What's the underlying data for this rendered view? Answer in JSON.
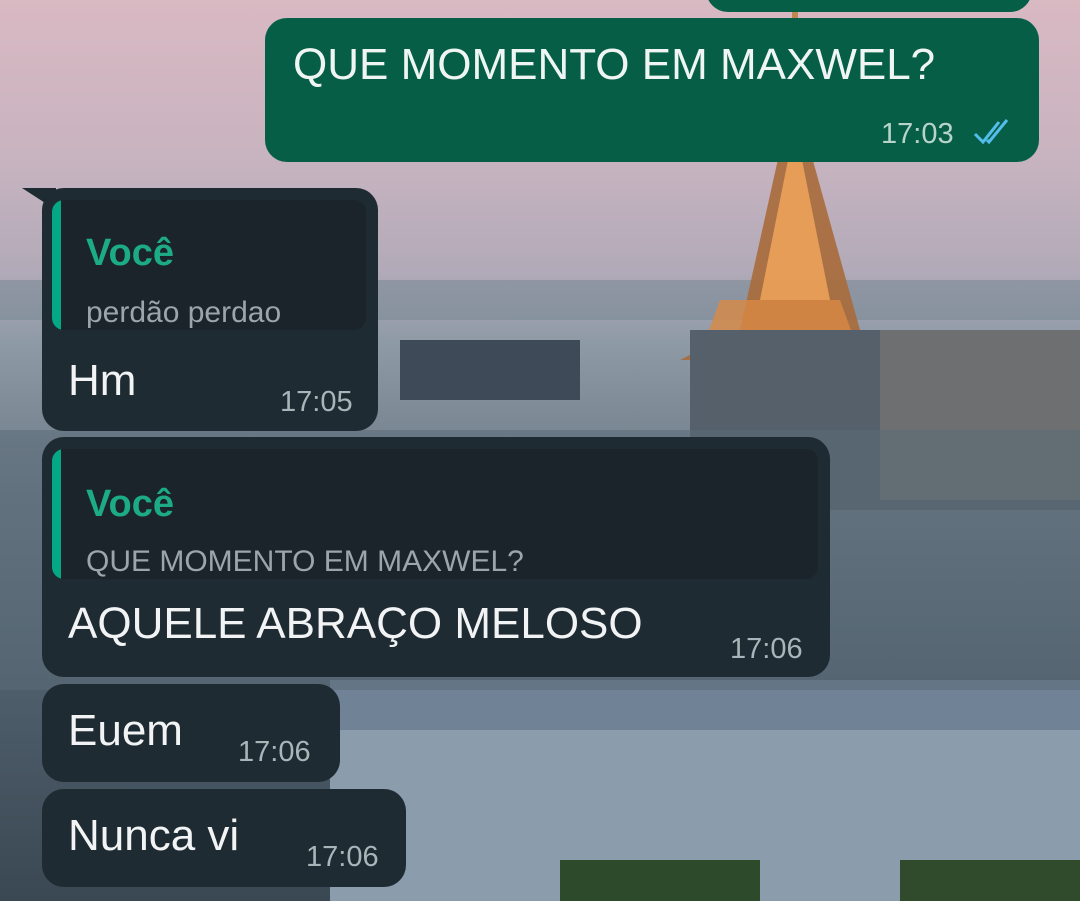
{
  "wallpaper": {
    "description_icon": "paris-eiffel-tower-wallpaper"
  },
  "colors": {
    "outgoing_bubble": "#075e47",
    "incoming_bubble": "#1f2b32",
    "quote_accent": "#05a884",
    "read_ticks": "#53bdeb"
  },
  "messages": [
    {
      "direction": "outgoing",
      "text": "QUE MOMENTO EM MAXWEL?",
      "time": "17:03",
      "status_icon": "double-check-read-icon"
    },
    {
      "direction": "incoming",
      "quote": {
        "author": "Você",
        "text": "perdão perdao"
      },
      "text": "Hm",
      "time": "17:05"
    },
    {
      "direction": "incoming",
      "quote": {
        "author": "Você",
        "text": "QUE MOMENTO EM MAXWEL?"
      },
      "text": "AQUELE ABRAÇO MELOSO",
      "time": "17:06"
    },
    {
      "direction": "incoming",
      "text": "Euem",
      "time": "17:06"
    },
    {
      "direction": "incoming",
      "text": "Nunca vi",
      "time": "17:06"
    }
  ]
}
